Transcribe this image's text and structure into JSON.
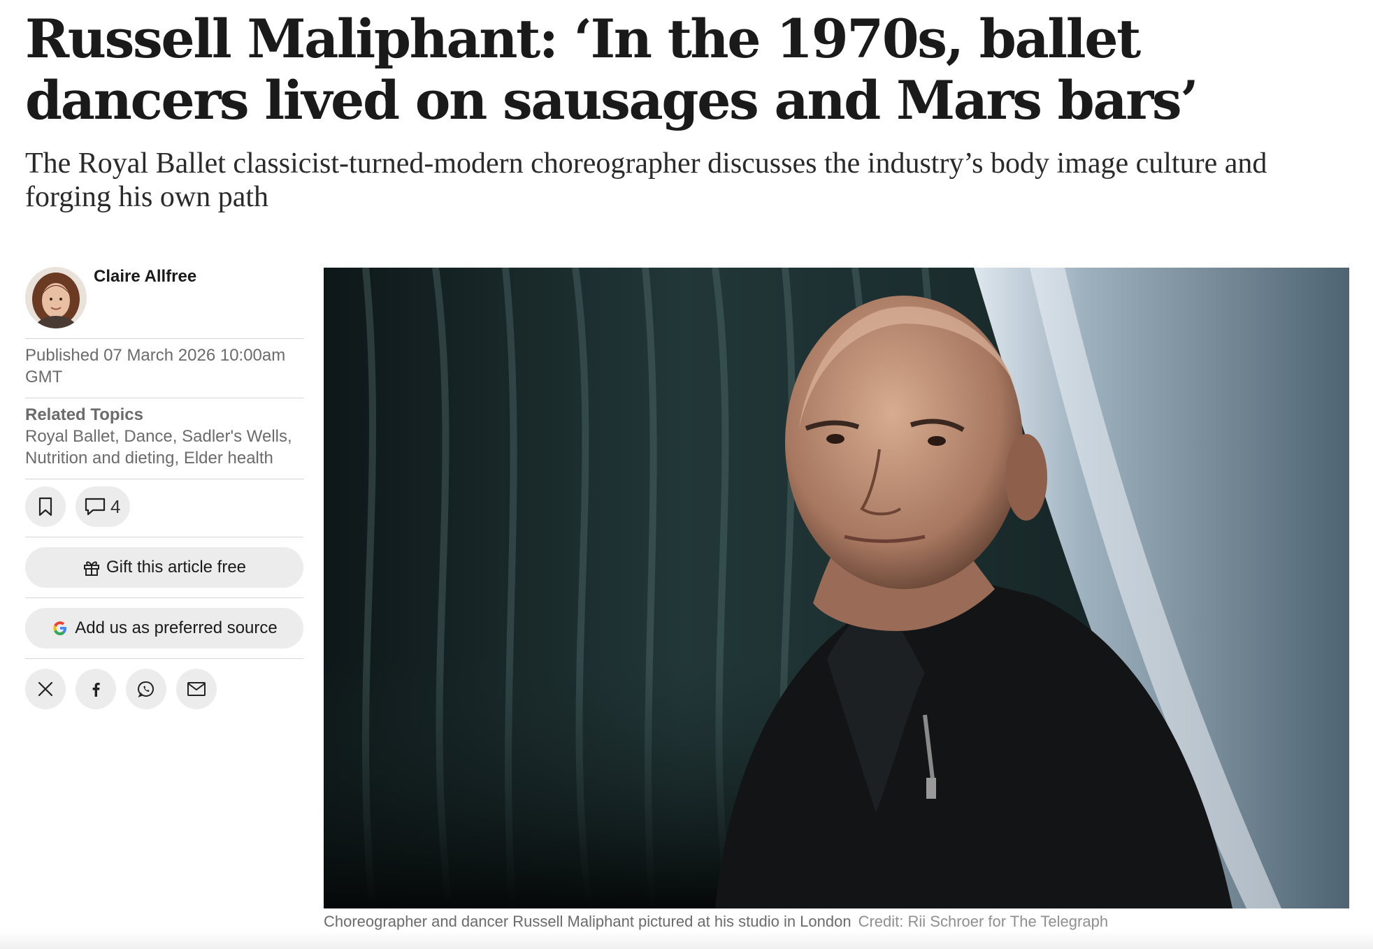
{
  "article": {
    "headline": "Russell Maliphant: ‘In the 1970s, ballet dancers lived on sausages and Mars bars’",
    "standfirst": "The Royal Ballet classicist-turned-modern choreographer discusses the industry’s body image culture and forging his own path"
  },
  "author": {
    "name": "Claire Allfree",
    "avatar_icon": "author-portrait"
  },
  "published": {
    "text": "Published 07 March 2026 10:00am GMT"
  },
  "related": {
    "heading": "Related Topics",
    "topics": [
      "Royal Ballet",
      "Dance",
      "Sadler's Wells",
      "Nutrition and dieting",
      "Elder health"
    ]
  },
  "actions": {
    "bookmark_icon": "bookmark-icon",
    "comment_icon": "speech-bubble-icon",
    "comment_count": "4",
    "gift_label": "Gift this article free",
    "preferred_source_label": "Add us as preferred source"
  },
  "share": {
    "icons": [
      "x-icon",
      "facebook-icon",
      "whatsapp-icon",
      "email-icon"
    ]
  },
  "image": {
    "caption": "Choreographer and dancer Russell Maliphant pictured at his studio in London",
    "credit": "Credit: Rii Schroer for The Telegraph"
  },
  "colors": {
    "text": "#1a1a1a",
    "muted": "#6b6b6b",
    "button_bg": "#ececec",
    "rule": "#d6d6d6"
  }
}
